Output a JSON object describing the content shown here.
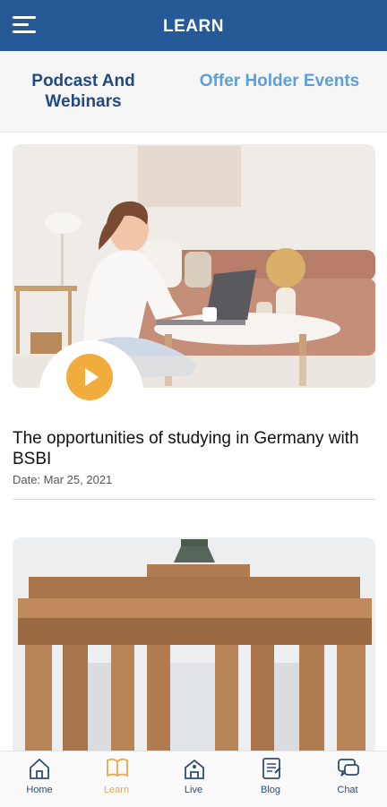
{
  "header": {
    "title": "LEARN",
    "menu_icon": "hamburger-menu-icon"
  },
  "tabs": [
    {
      "label": "Podcast And Webinars",
      "active": true
    },
    {
      "label": "Offer Holder Events",
      "active": false
    }
  ],
  "cards": [
    {
      "image": "woman-working-on-laptop-photo",
      "play_icon": "play-icon",
      "title": "The opportunities of studying in Germany with BSBI",
      "date": "Date: Mar 25, 2021"
    },
    {
      "image": "brandenburg-gate-photo"
    }
  ],
  "bottom_nav": [
    {
      "label": "Home",
      "icon": "home-icon",
      "active": false
    },
    {
      "label": "Learn",
      "icon": "book-icon",
      "active": true
    },
    {
      "label": "Live",
      "icon": "live-icon",
      "active": false
    },
    {
      "label": "Blog",
      "icon": "blog-icon",
      "active": false
    },
    {
      "label": "Chat",
      "icon": "chat-icon",
      "active": false
    }
  ],
  "colors": {
    "primary": "#265a96",
    "accent": "#f0ad3e",
    "tab_active": "#1f4b82",
    "tab_inactive": "#5d9fda"
  }
}
